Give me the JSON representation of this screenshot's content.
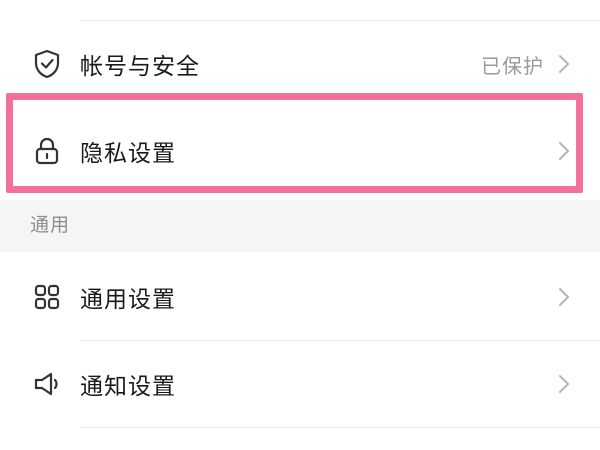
{
  "colors": {
    "highlight": "#f2709a",
    "background": "#f5f5f5",
    "card": "#ffffff",
    "text": "#1a1a1a",
    "secondary_text": "#9a9a9a"
  },
  "items": {
    "account": {
      "label": "帐号与安全",
      "value": "已保护",
      "icon": "shield-check-icon"
    },
    "privacy": {
      "label": "隐私设置",
      "icon": "lock-icon"
    },
    "general_settings": {
      "label": "通用设置",
      "icon": "grid-icon"
    },
    "notifications": {
      "label": "通知设置",
      "icon": "speaker-icon"
    }
  },
  "sections": {
    "general": "通用"
  }
}
